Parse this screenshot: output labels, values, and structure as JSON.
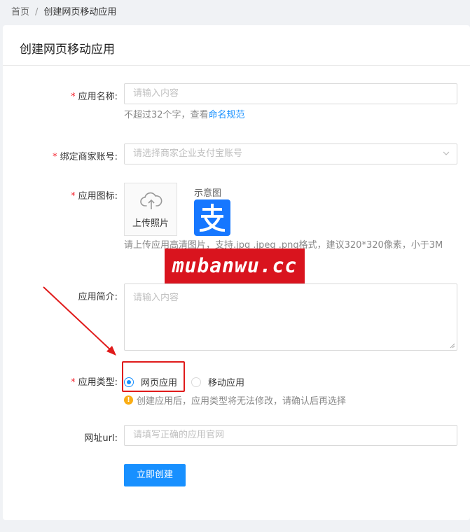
{
  "breadcrumb": {
    "home": "首页",
    "separator": "/",
    "current": "创建网页移动应用"
  },
  "card": {
    "title": "创建网页移动应用"
  },
  "form": {
    "required_mark": "*",
    "app_name": {
      "label": "应用名称:",
      "placeholder": "请输入内容",
      "hint_prefix": "不超过32个字，查看",
      "hint_link": "命名规范"
    },
    "merchant": {
      "label": "绑定商家账号:",
      "placeholder": "请选择商家企业支付宝账号"
    },
    "icon": {
      "label": "应用图标:",
      "upload_label": "上传照片",
      "sample_label": "示意图",
      "hint": "请上传应用高清图片，支持.jpg .jpeg .png格式，建议320*320像素，小于3M"
    },
    "intro": {
      "label": "应用简介:",
      "placeholder": "请输入内容"
    },
    "type": {
      "label": "应用类型:",
      "options": [
        "网页应用",
        "移动应用"
      ],
      "selected": "网页应用",
      "warning": "创建应用后，应用类型将无法修改，请确认后再选择"
    },
    "url": {
      "label": "网址url:",
      "placeholder": "请填写正确的应用官网"
    },
    "submit_label": "立即创建"
  },
  "watermark": "mubanwu.cc",
  "colors": {
    "primary": "#1890ff",
    "required": "#f5222d",
    "highlight": "#e01b1b",
    "warning": "#faad14",
    "alipay": "#1677ff"
  }
}
